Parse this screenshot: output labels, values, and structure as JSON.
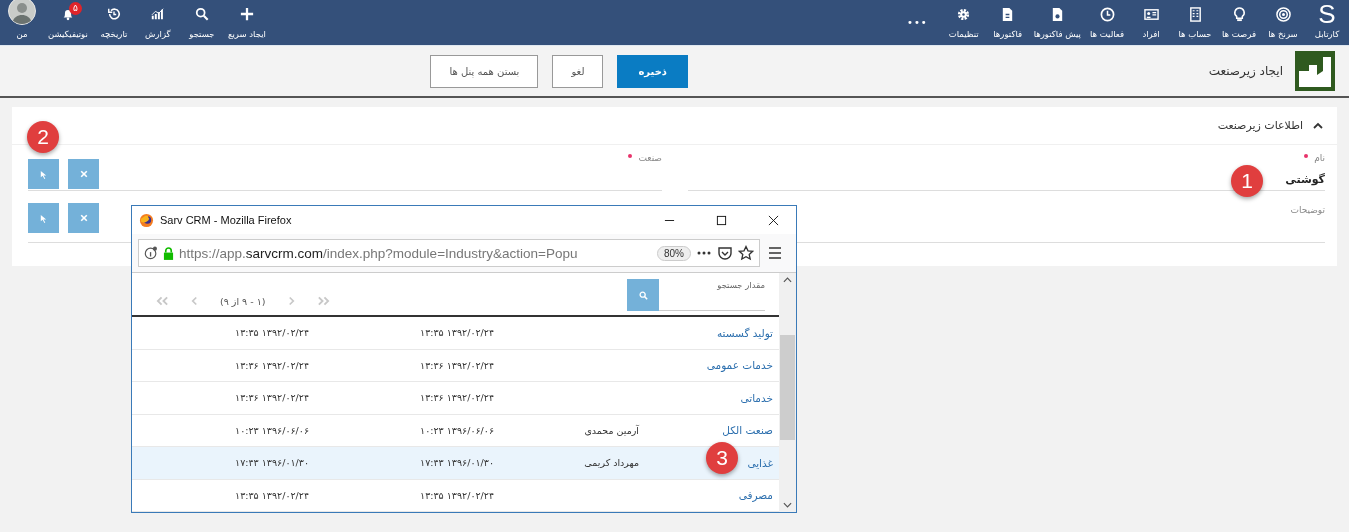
{
  "nav": {
    "logo": "S",
    "main_items": [
      {
        "label": "کارتابل"
      },
      {
        "label": "سرنخ ها"
      },
      {
        "label": "فرصت ها"
      },
      {
        "label": "حساب ها"
      },
      {
        "label": "افراد"
      },
      {
        "label": "فعالیت ها"
      },
      {
        "label": "پیش فاکتورها"
      },
      {
        "label": "فاکتورها"
      },
      {
        "label": "تنظیمات"
      }
    ],
    "more": "•••",
    "user_items": [
      {
        "label": "ایجاد سریع"
      },
      {
        "label": "جستجو"
      },
      {
        "label": "گزارش"
      },
      {
        "label": "تاریخچه"
      },
      {
        "label": "نوتیفیکیشن",
        "badge": "۵"
      },
      {
        "label": "من"
      }
    ]
  },
  "toolbar": {
    "title": "ایجاد زیرصنعت",
    "buttons": [
      {
        "label": "ذخیره",
        "primary": true
      },
      {
        "label": "لغو",
        "primary": false
      },
      {
        "label": "بستن همه پنل ها",
        "primary": false
      }
    ]
  },
  "panel": {
    "title": "اطلاعات زیرصنعت",
    "expanded": true,
    "fields": [
      {
        "kind": "text",
        "label": "نام",
        "required": true,
        "value": "گوشتی"
      },
      {
        "kind": "lookup",
        "label": "صنعت",
        "required": true
      },
      {
        "kind": "text",
        "label": "توضیحات",
        "required": false
      },
      {
        "kind": "lookup"
      }
    ]
  },
  "popup": {
    "title": "Sarv CRM - Mozilla Firefox",
    "url_start": "https://app.",
    "url_domain": "sarvcrm.com",
    "url_rest": "/index.php?module=Industry&action=Popu",
    "zoom": "80%",
    "search_label": "مقدار جستجو",
    "pagination": "(۱ - ۹ از ۹)",
    "rows": [
      {
        "name": "تولید گسسته",
        "user": "",
        "created": "۱۳۹۲/۰۲/۲۴ ۱۳:۳۵",
        "modified": "۱۳۹۲/۰۲/۲۴ ۱۳:۳۵",
        "selected": false
      },
      {
        "name": "خدمات عمومی",
        "user": "",
        "created": "۱۳۹۲/۰۲/۲۴ ۱۳:۳۶",
        "modified": "۱۳۹۲/۰۲/۲۴ ۱۳:۳۶",
        "selected": false
      },
      {
        "name": "خدماتی",
        "user": "",
        "created": "۱۳۹۲/۰۲/۲۴ ۱۳:۳۶",
        "modified": "۱۳۹۲/۰۲/۲۴ ۱۳:۳۶",
        "selected": false
      },
      {
        "name": "صنعت الکل",
        "user": "آرمین محمدی",
        "created": "۱۳۹۶/۰۶/۰۶ ۱۰:۲۳",
        "modified": "۱۳۹۶/۰۶/۰۶ ۱۰:۲۳",
        "selected": false
      },
      {
        "name": "غذایی",
        "user": "مهرداد کریمی",
        "created": "۱۳۹۶/۰۱/۳۰ ۱۷:۴۳",
        "modified": "۱۳۹۶/۰۱/۳۰ ۱۷:۴۳",
        "selected": true
      },
      {
        "name": "مصرفی",
        "user": "",
        "created": "۱۳۹۲/۰۲/۲۴ ۱۳:۳۵",
        "modified": "۱۳۹۲/۰۲/۲۴ ۱۳:۳۵",
        "selected": false
      }
    ]
  },
  "markers": [
    {
      "number": "1"
    },
    {
      "number": "2"
    },
    {
      "number": "3"
    }
  ]
}
